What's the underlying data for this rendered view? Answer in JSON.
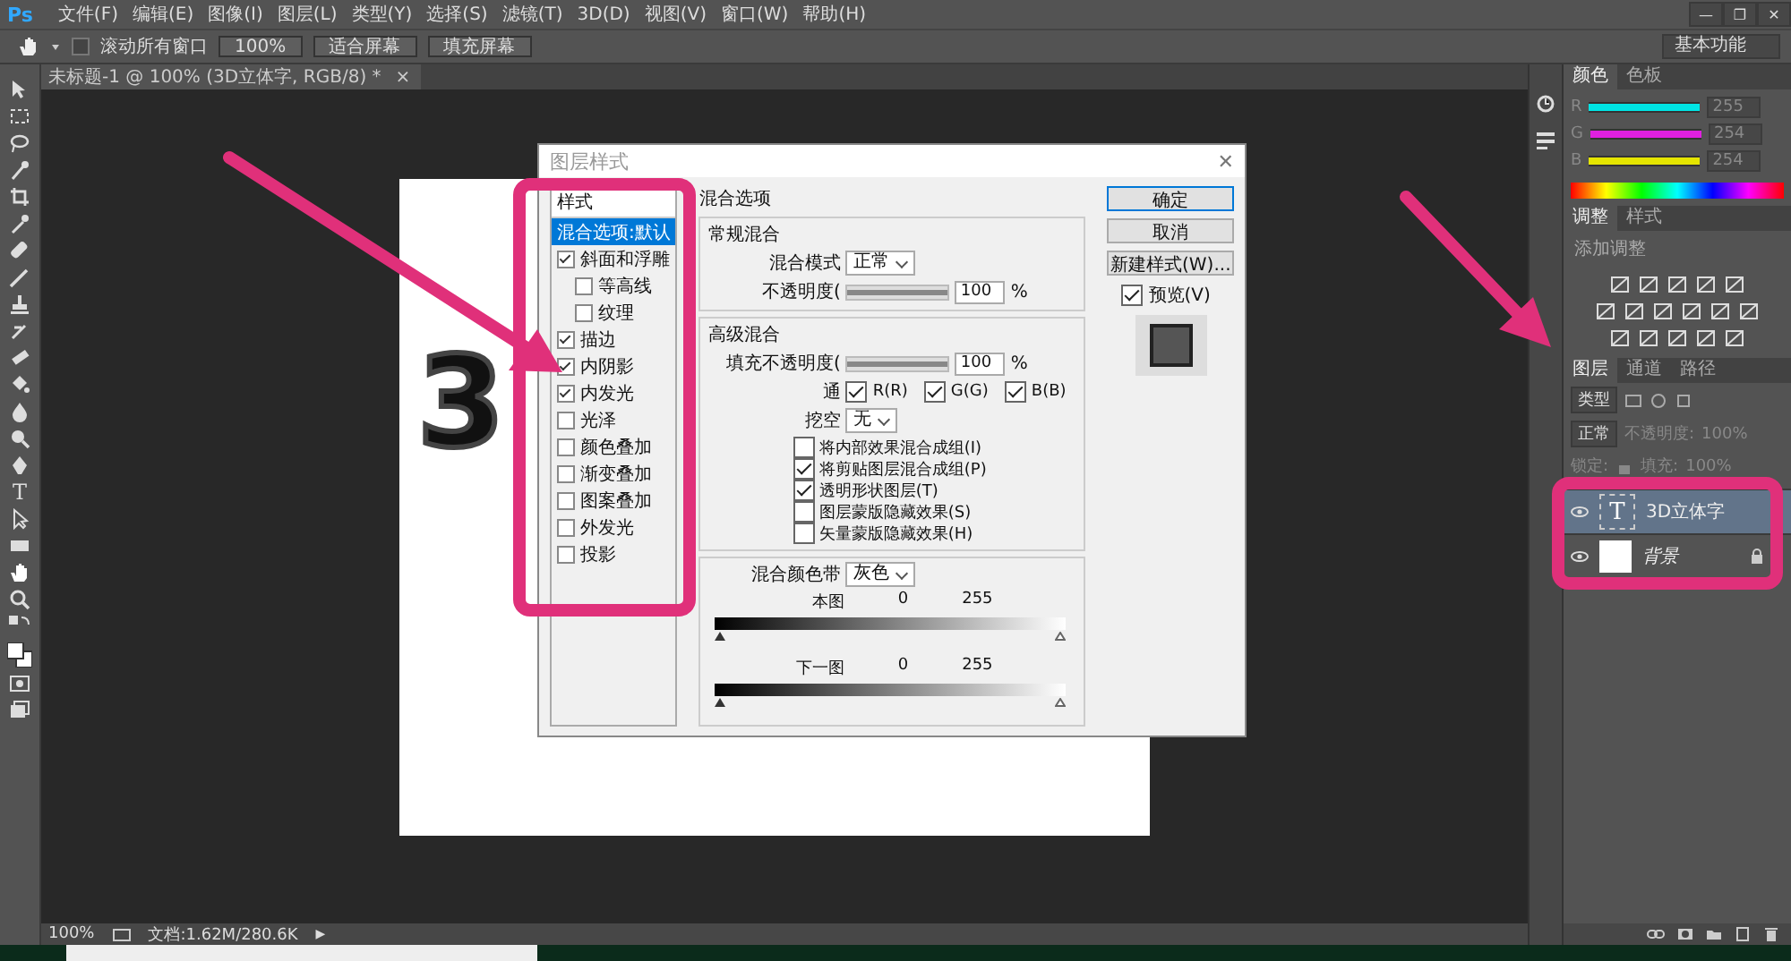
{
  "app": {
    "logo": "Ps",
    "window_controls": [
      "—",
      "❐",
      "✕"
    ]
  },
  "menu": [
    "文件(F)",
    "编辑(E)",
    "图像(I)",
    "图层(L)",
    "类型(Y)",
    "选择(S)",
    "滤镜(T)",
    "3D(D)",
    "视图(V)",
    "窗口(W)",
    "帮助(H)"
  ],
  "options_bar": {
    "scroll_all": {
      "label": "滚动所有窗口",
      "checked": false
    },
    "buttons": [
      "100%",
      "适合屏幕",
      "填充屏幕"
    ],
    "workspace": "基本功能"
  },
  "tools": {
    "type_glyph": "T"
  },
  "document": {
    "tab": "未标题-1 @ 100% (3D立体字, RGB/8) *",
    "tab_close": "×",
    "canvas_text": "3"
  },
  "status_bar": {
    "zoom": "100%",
    "doc_info": "文档:1.62M/280.6K",
    "menu_arrow": "▶"
  },
  "dialog": {
    "title": "图层样式",
    "close": "✕",
    "styles_header": "样式",
    "styles": [
      {
        "label": "混合选项:默认",
        "kind": "plain",
        "selected": true
      },
      {
        "label": "斜面和浮雕",
        "kind": "check",
        "checked": true,
        "selected": false,
        "children": [
          {
            "label": "等高线",
            "checked": false,
            "selected": false
          },
          {
            "label": "纹理",
            "checked": false,
            "selected": false
          }
        ]
      },
      {
        "label": "描边",
        "kind": "check",
        "checked": true,
        "selected": false
      },
      {
        "label": "内阴影",
        "kind": "check",
        "checked": true,
        "selected": false
      },
      {
        "label": "内发光",
        "kind": "check",
        "checked": true,
        "selected": false
      },
      {
        "label": "光泽",
        "kind": "check",
        "checked": false,
        "selected": false
      },
      {
        "label": "颜色叠加",
        "kind": "check",
        "checked": false,
        "selected": false
      },
      {
        "label": "渐变叠加",
        "kind": "check",
        "checked": false,
        "selected": false
      },
      {
        "label": "图案叠加",
        "kind": "check",
        "checked": false,
        "selected": false
      },
      {
        "label": "外发光",
        "kind": "check",
        "checked": false,
        "selected": false
      },
      {
        "label": "投影",
        "kind": "check",
        "checked": false,
        "selected": false
      }
    ],
    "blending": {
      "title": "混合选项",
      "general": {
        "title": "常规混合",
        "mode_label": "混合模式",
        "mode": "正常",
        "opacity_label": "不透明度(",
        "opacity": {
          "level": 1,
          "value": "100",
          "unit": "%"
        }
      },
      "advanced": {
        "title": "高级混合",
        "fill_label": "填充不透明度(",
        "fill": {
          "level": 1,
          "value": "100",
          "unit": "%"
        },
        "channels_label": "通",
        "channels": [
          {
            "label": "R(R)",
            "checked": true
          },
          {
            "label": "G(G)",
            "checked": true
          },
          {
            "label": "B(B)",
            "checked": true
          }
        ],
        "knockout_label": "挖空",
        "knockout": "无",
        "options": [
          {
            "label": "将内部效果混合成组(I)",
            "checked": false
          },
          {
            "label": "将剪贴图层混合成组(P)",
            "checked": true
          },
          {
            "label": "透明形状图层(T)",
            "checked": true
          },
          {
            "label": "图层蒙版隐藏效果(S)",
            "checked": false
          },
          {
            "label": "矢量蒙版隐藏效果(H)",
            "checked": false
          }
        ]
      },
      "blend_if": {
        "label": "混合颜色带",
        "value": "灰色",
        "bands": [
          {
            "label": "本图",
            "min": "0",
            "max": "255",
            "level": 1
          },
          {
            "label": "下一图",
            "min": "0",
            "max": "255",
            "level": 1
          }
        ]
      }
    },
    "buttons": [
      "确定",
      "取消",
      "新建样式(W)..."
    ],
    "preview": {
      "label": "预览(V)",
      "checked": true
    }
  },
  "panels": {
    "color": {
      "tabs": [
        {
          "label": "颜色",
          "selected": true
        },
        {
          "label": "色板",
          "selected": false
        }
      ],
      "channels": [
        {
          "label": "R",
          "value": "255",
          "level": 1,
          "color": "#00e5e5"
        },
        {
          "label": "G",
          "value": "254",
          "level": 0.996,
          "color": "#e020e0"
        },
        {
          "label": "B",
          "value": "254",
          "level": 0.996,
          "color": "#e5e500"
        }
      ]
    },
    "adjustments": {
      "tabs": [
        {
          "label": "调整",
          "selected": true
        },
        {
          "label": "样式",
          "selected": false
        }
      ],
      "title": "添加调整"
    },
    "layers": {
      "tabs": [
        {
          "label": "图层",
          "selected": true
        },
        {
          "label": "通道",
          "selected": false
        },
        {
          "label": "路径",
          "selected": false
        }
      ],
      "filter": "类型",
      "blend_mode": "正常",
      "opacity_label": "不透明度:",
      "opacity": "100%",
      "lock_label": "锁定:",
      "fill_label": "填充:",
      "fill": "100%",
      "layers": [
        {
          "name": "3D立体字",
          "kind": "text",
          "thumb_glyph": "T",
          "selected": true,
          "locked": false
        },
        {
          "name": "背景",
          "kind": "image",
          "selected": false,
          "locked": true
        }
      ]
    }
  }
}
